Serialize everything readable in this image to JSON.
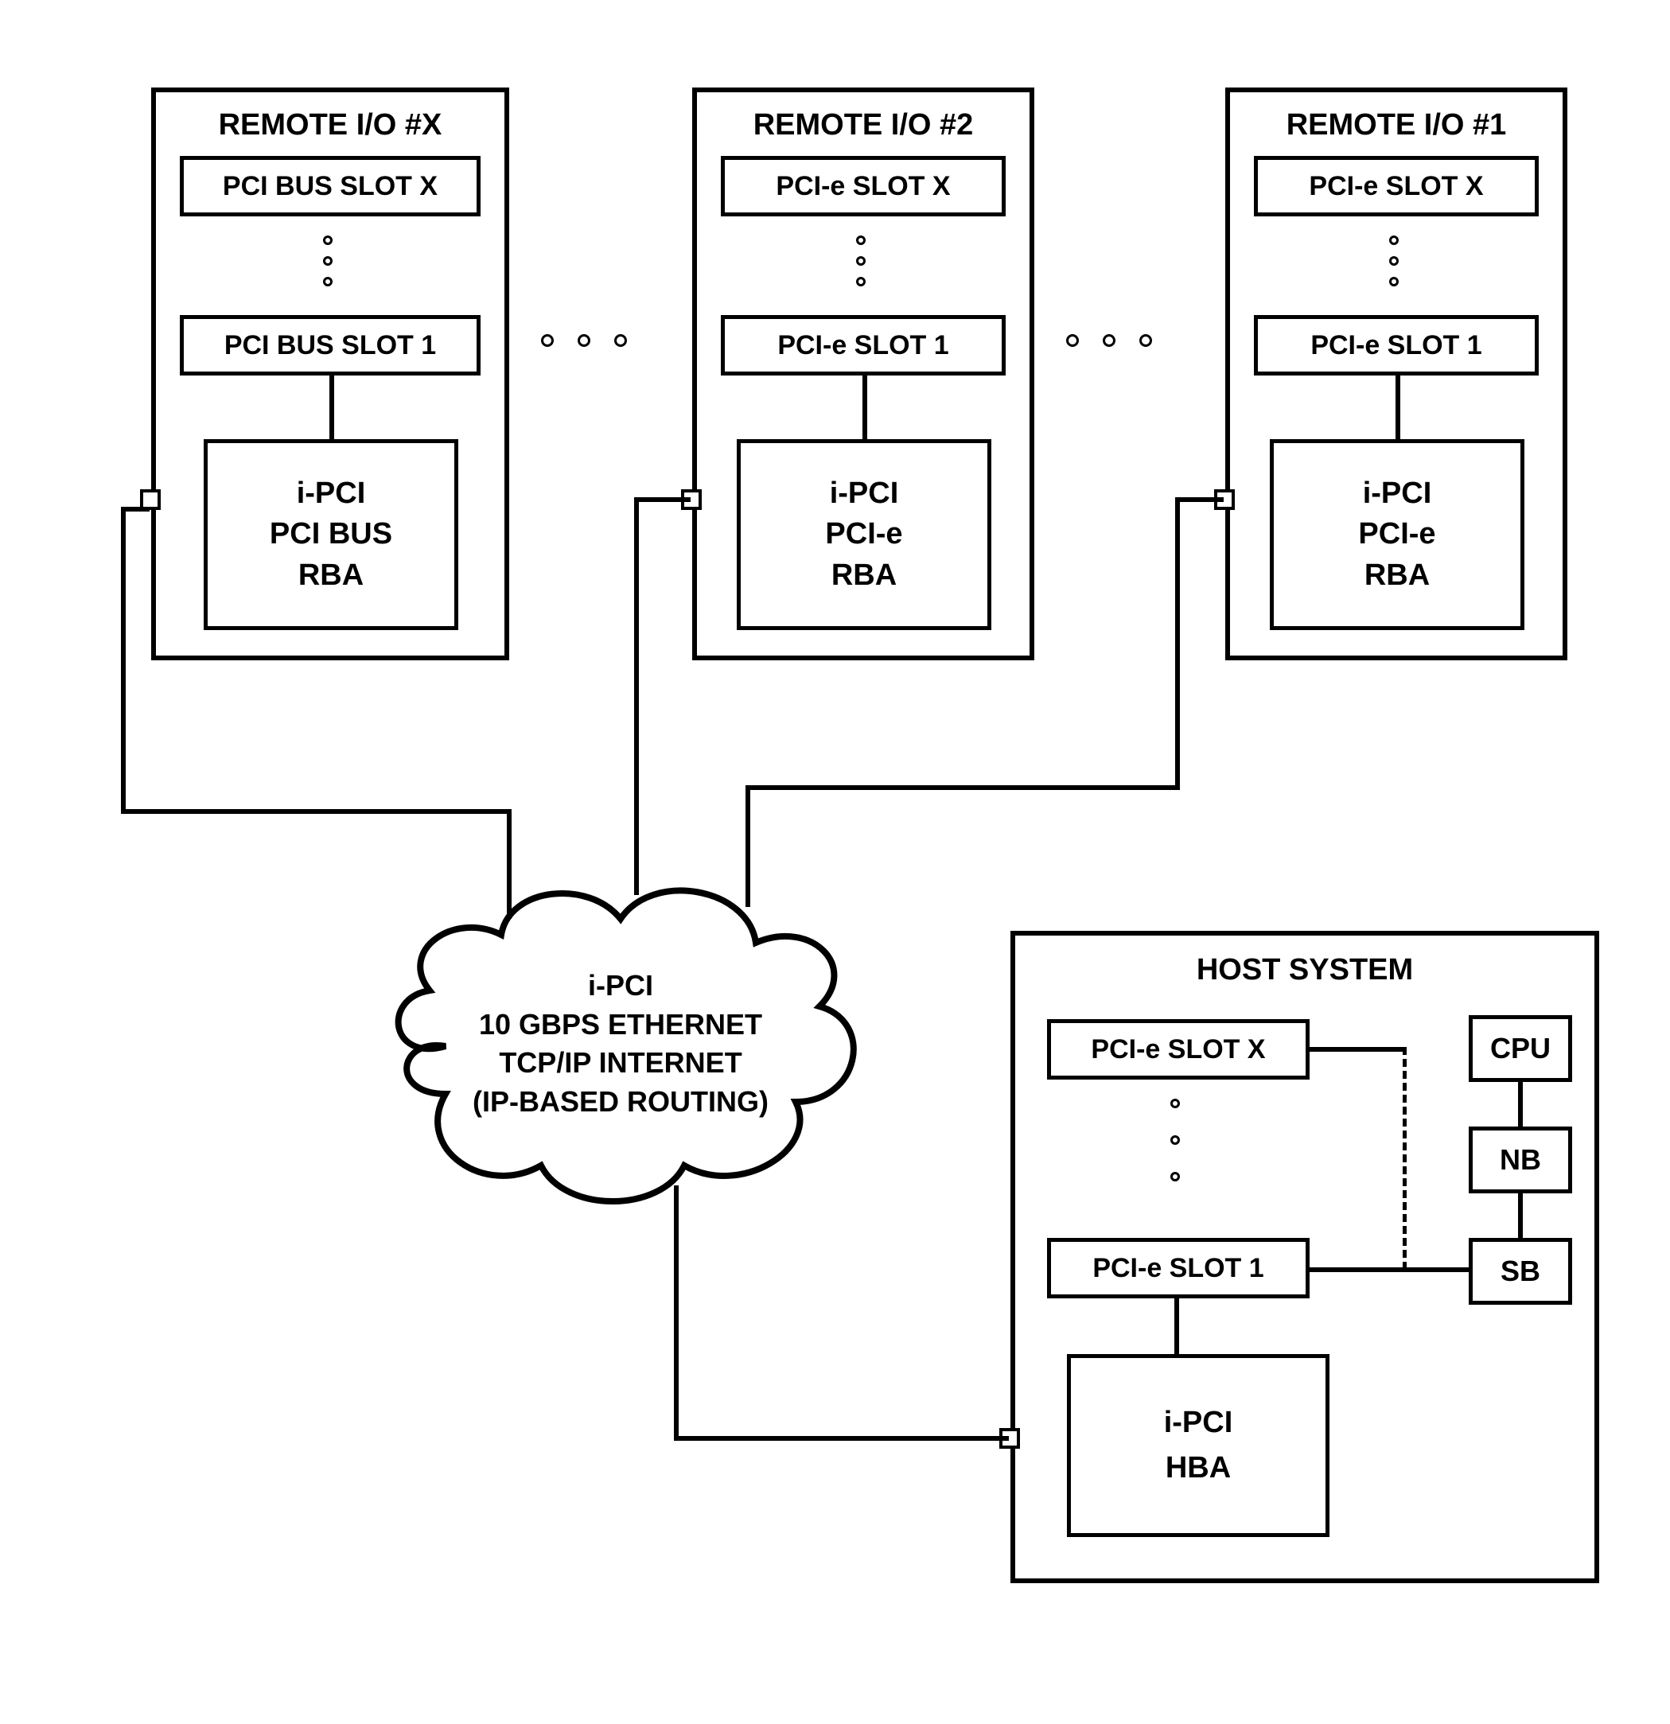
{
  "remotes": [
    {
      "title": "REMOTE I/O #X",
      "slotX": "PCI BUS SLOT X",
      "slot1": "PCI BUS SLOT 1",
      "rba": {
        "l1": "i-PCI",
        "l2": "PCI BUS",
        "l3": "RBA"
      }
    },
    {
      "title": "REMOTE I/O #2",
      "slotX": "PCI-e SLOT X",
      "slot1": "PCI-e SLOT 1",
      "rba": {
        "l1": "i-PCI",
        "l2": "PCI-e",
        "l3": "RBA"
      }
    },
    {
      "title": "REMOTE I/O #1",
      "slotX": "PCI-e SLOT X",
      "slot1": "PCI-e SLOT 1",
      "rba": {
        "l1": "i-PCI",
        "l2": "PCI-e",
        "l3": "RBA"
      }
    }
  ],
  "cloud": {
    "l1": "i-PCI",
    "l2": "10 GBPS ETHERNET",
    "l3": "TCP/IP INTERNET",
    "l4": "(IP-BASED ROUTING)"
  },
  "host": {
    "title": "HOST SYSTEM",
    "slotX": "PCI-e SLOT X",
    "slot1": "PCI-e SLOT 1",
    "cpu": "CPU",
    "nb": "NB",
    "sb": "SB",
    "hba": {
      "l1": "i-PCI",
      "l2": "HBA"
    }
  }
}
